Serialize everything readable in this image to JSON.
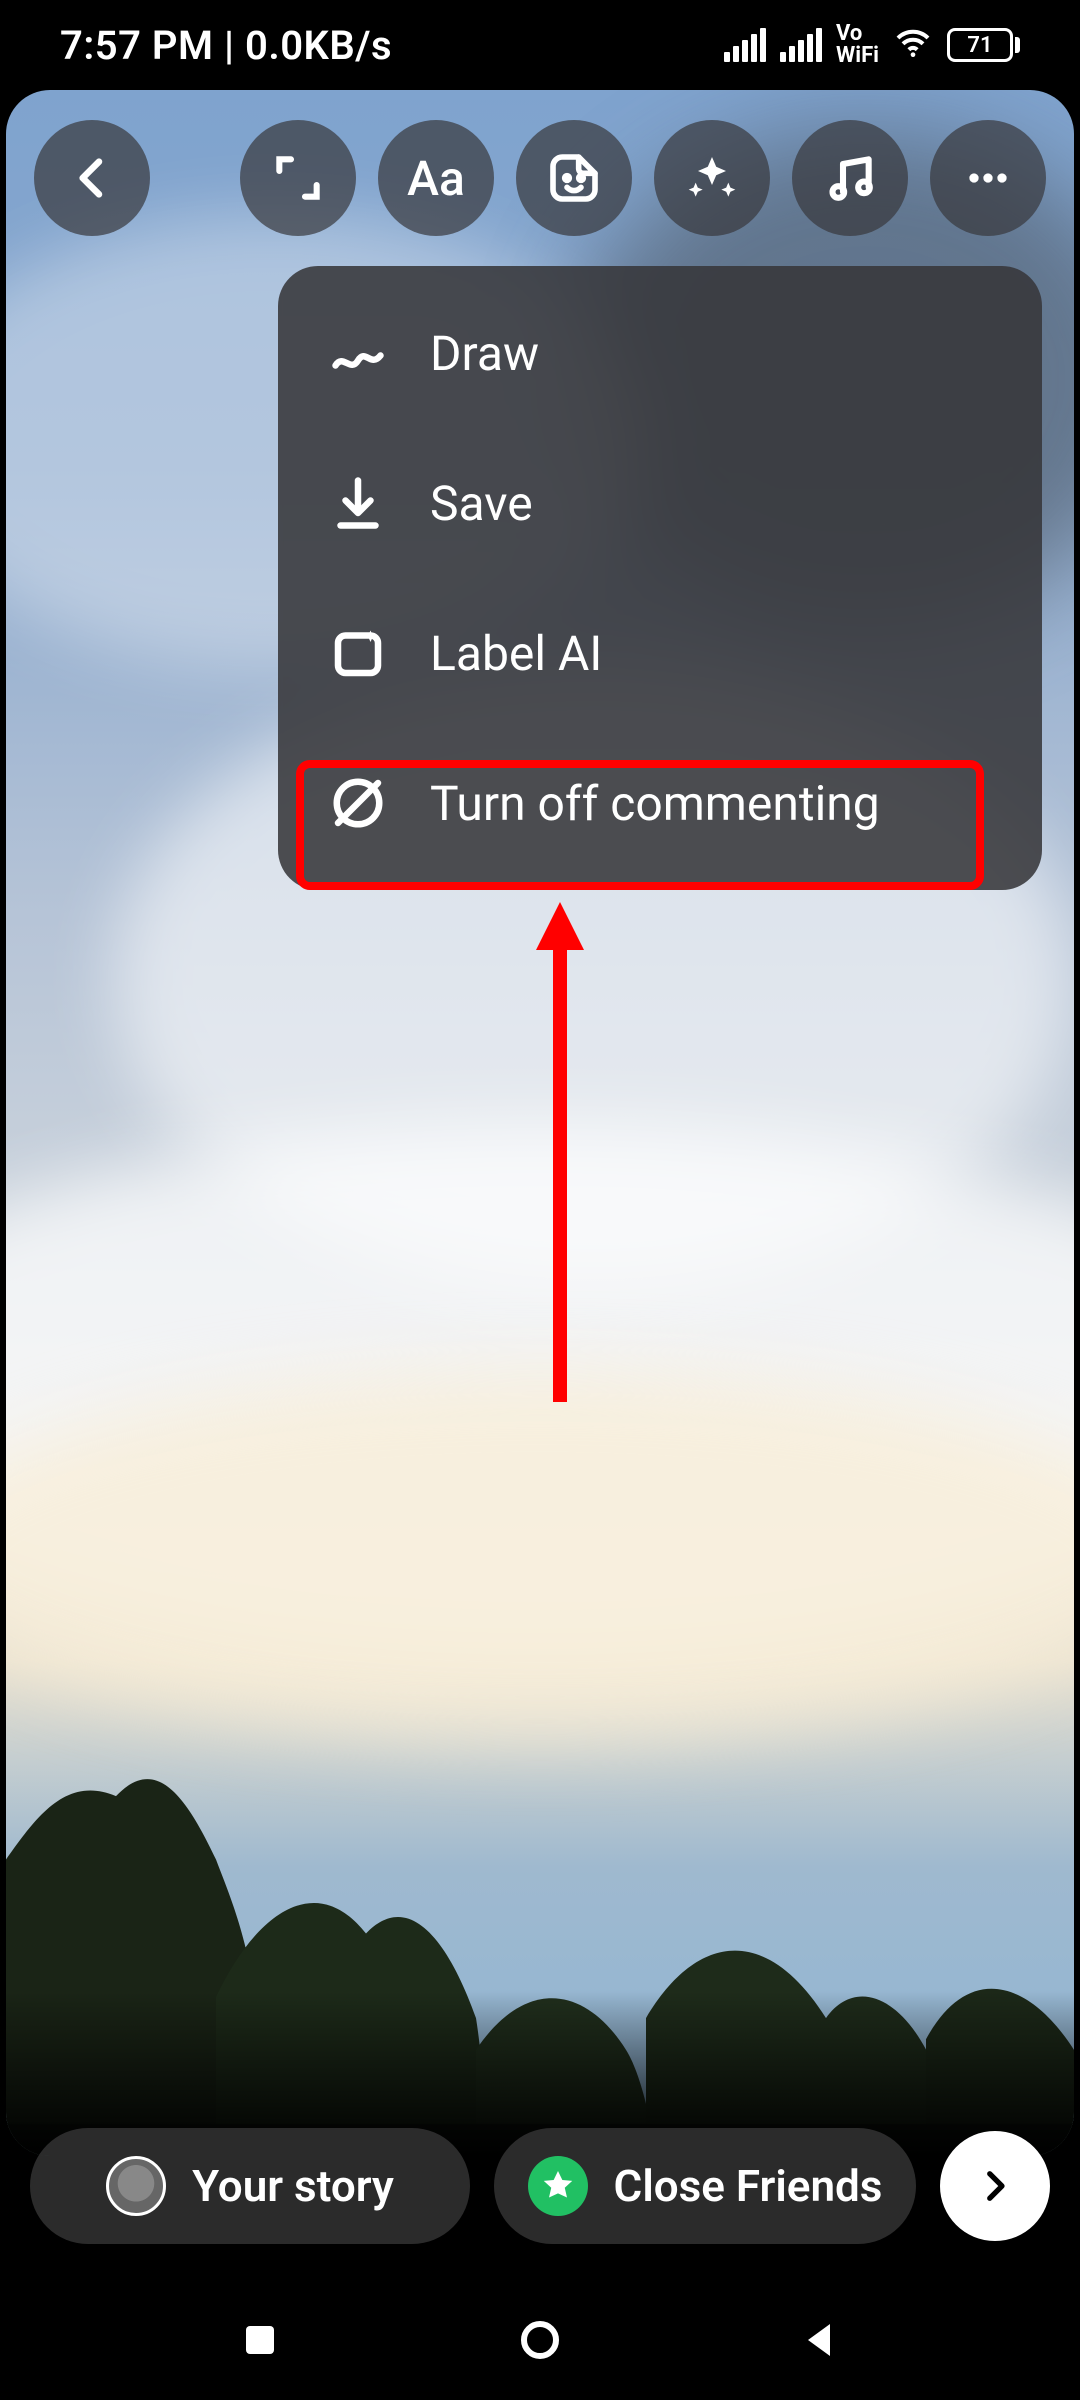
{
  "statusbar": {
    "time": "7:57 PM",
    "net_speed": "0.0KB/s",
    "vowifi_top": "Vo",
    "vowifi_bottom": "WiFi",
    "battery_pct": "71"
  },
  "toolbar": {
    "back_icon": "chevron-left",
    "crop_icon": "resize",
    "text_label": "Aa",
    "sticker_icon": "sticker",
    "effects_icon": "sparkle",
    "music_icon": "music",
    "more_icon": "more"
  },
  "dropdown": {
    "items": [
      {
        "icon": "scribble",
        "label": "Draw"
      },
      {
        "icon": "download",
        "label": "Save"
      },
      {
        "icon": "ai-box",
        "label": "Label AI"
      },
      {
        "icon": "comment-off",
        "label": "Turn off commenting"
      }
    ]
  },
  "annotation": {
    "highlight_color": "#ff0000",
    "arrow_color": "#ff0000"
  },
  "bottom": {
    "your_story_label": "Your story",
    "close_friends_label": "Close Friends"
  }
}
